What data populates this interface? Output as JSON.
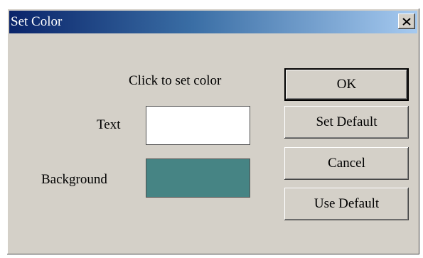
{
  "window": {
    "title": "Set Color"
  },
  "form": {
    "instruction": "Click to set color",
    "text_label": "Text",
    "background_label": "Background"
  },
  "colors": {
    "text_swatch": "#ffffff",
    "background_swatch": "#468484"
  },
  "buttons": {
    "ok": "OK",
    "set_default": "Set Default",
    "cancel": "Cancel",
    "use_default": "Use Default"
  },
  "icons": {
    "close": "close-icon"
  }
}
